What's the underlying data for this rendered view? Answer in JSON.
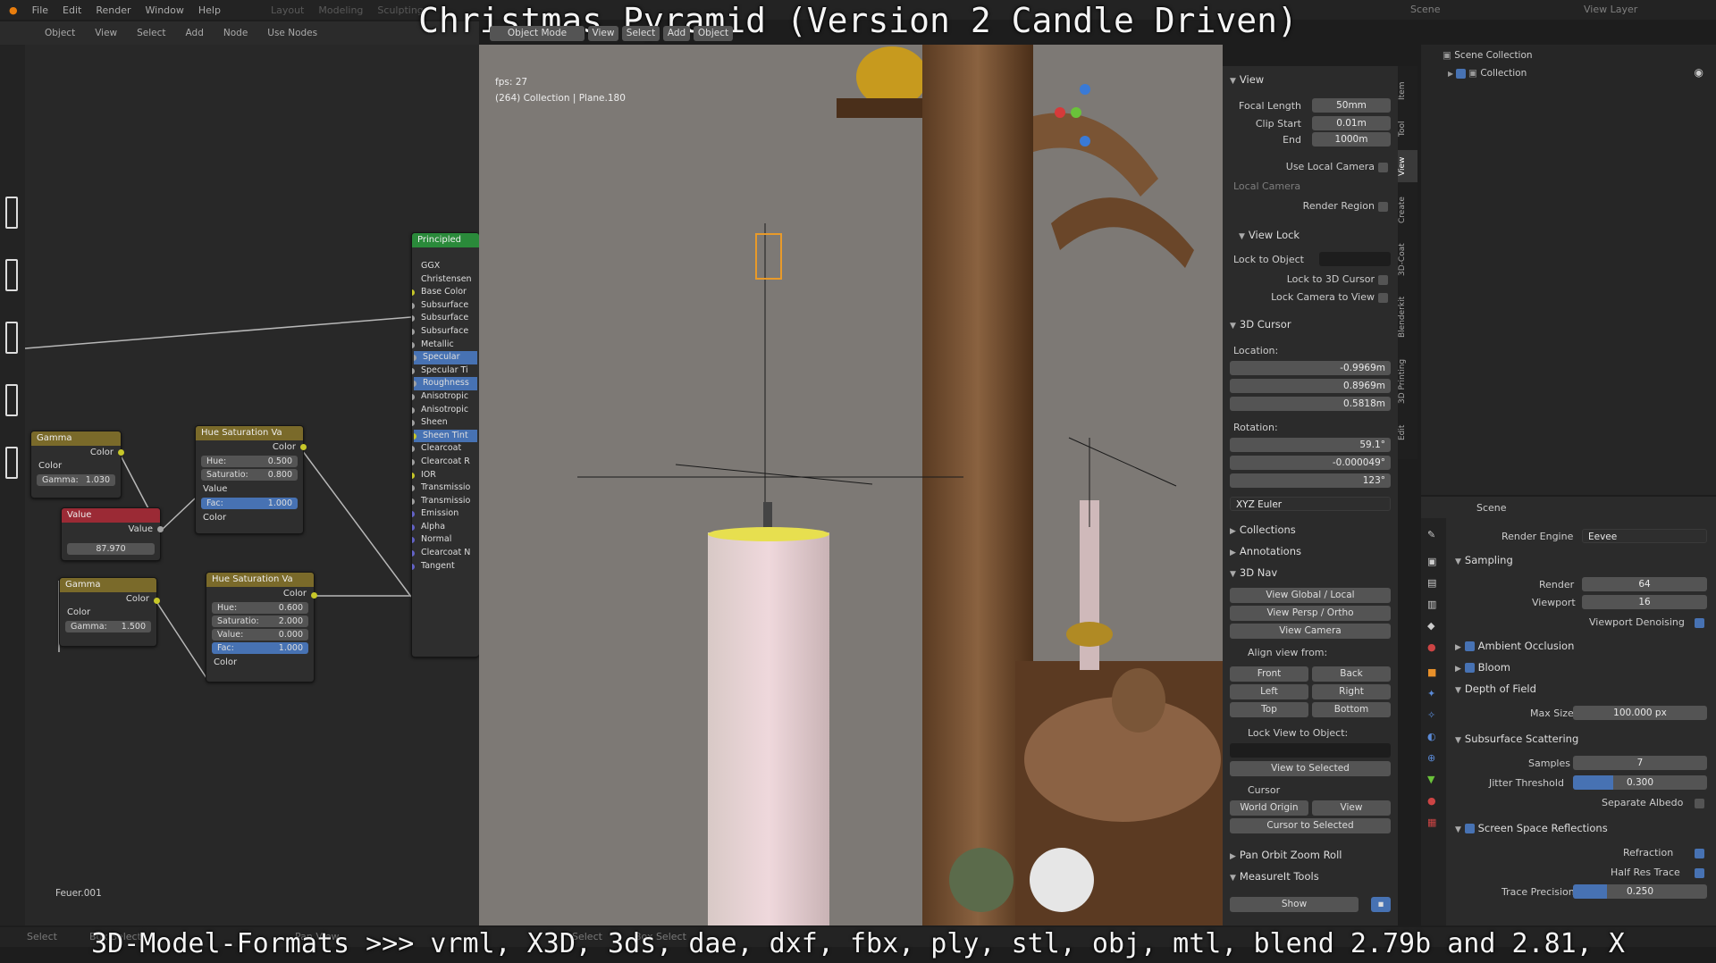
{
  "top_menu": [
    "File",
    "Edit",
    "Render",
    "Window",
    "Help"
  ],
  "workspace_tabs": [
    "Layout",
    "Modeling",
    "Sculpting"
  ],
  "overlay_title": "Christmas Pyramid (Version 2 Candle Driven)",
  "overlay_bottom": "3D-Model-Formats >>> vrml, X3D, 3ds, dae, dxf, fbx, ply, stl, obj, mtl, blend 2.79b and 2.81, X",
  "scene_label": "Scene",
  "view_layer_label": "View Layer",
  "node_editor": {
    "header": [
      "Object",
      "View",
      "Select",
      "Add",
      "Node",
      "Use Nodes"
    ],
    "footer_label": "Feuer.001",
    "nodes": {
      "gamma1": {
        "title": "Gamma",
        "out": "Color",
        "in": "Color",
        "field_label": "Gamma:",
        "field_value": "1.030"
      },
      "value": {
        "title": "Value",
        "out": "Value",
        "field_value": "87.970"
      },
      "gamma2": {
        "title": "Gamma",
        "out": "Color",
        "in": "Color",
        "field_label": "Gamma:",
        "field_value": "1.500"
      },
      "hsv1": {
        "title": "Hue Saturation Va",
        "out": "Color",
        "hue": "0.500",
        "sat": "0.800",
        "val": "Value",
        "fac": "1.000",
        "in": "Color",
        "hue_label": "Hue:",
        "sat_label": "Saturatio:",
        "fac_label": "Fac:"
      },
      "hsv2": {
        "title": "Hue Saturation Va",
        "out": "Color",
        "hue": "0.600",
        "sat": "2.000",
        "val": "0.000",
        "fac": "1.000",
        "in": "Color",
        "hue_label": "Hue:",
        "sat_label": "Saturatio:",
        "val_label": "Value:",
        "fac_label": "Fac:"
      },
      "principled": {
        "title": "Principled",
        "inputs": [
          "GGX",
          "Christensen",
          "Base Color",
          "Subsurface",
          "Subsurface",
          "Subsurface",
          "Metallic",
          "Specular",
          "Specular Ti",
          "Roughness",
          "Anisotropic",
          "Anisotropic",
          "Sheen",
          "Sheen Tint",
          "Clearcoat",
          "Clearcoat R",
          "IOR",
          "Transmissio",
          "Transmissio",
          "Emission",
          "Alpha",
          "Normal",
          "Clearcoat N",
          "Tangent"
        ]
      }
    }
  },
  "viewport": {
    "header": [
      "Object Mode",
      "View",
      "Select",
      "Add",
      "Object"
    ],
    "fps": "fps: 27",
    "collection_info": "(264) Collection | Plane.180"
  },
  "npanel": {
    "view": {
      "title": "View",
      "focal_label": "Focal Length",
      "focal": "50mm",
      "clip_start_label": "Clip Start",
      "clip_start": "0.01m",
      "end_label": "End",
      "end": "1000m",
      "use_local_camera": "Use Local Camera",
      "local_camera": "Local Camera",
      "render_region": "Render Region"
    },
    "view_lock": {
      "title": "View Lock",
      "lock_to_object": "Lock to Object",
      "lock_3d_cursor": "Lock to 3D Cursor",
      "lock_camera": "Lock Camera to View"
    },
    "cursor": {
      "title": "3D Cursor",
      "location": "Location:",
      "x": "-0.9969m",
      "y": "0.8969m",
      "z": "0.5818m",
      "rotation": "Rotation:",
      "rx": "59.1°",
      "ry": "-0.000049°",
      "rz": "123°",
      "mode": "XYZ Euler"
    },
    "collections": "Collections",
    "annotations": "Annotations",
    "nav": {
      "title": "3D Nav",
      "global_local": "View Global / Local",
      "persp_ortho": "View Persp / Ortho",
      "view_camera": "View Camera",
      "align_from": "Align view from:",
      "front": "Front",
      "back": "Back",
      "left": "Left",
      "right": "Right",
      "top": "Top",
      "bottom": "Bottom",
      "lock_view": "Lock View to Object:",
      "view_selected": "View to Selected",
      "cursor": "Cursor",
      "world_origin": "World Origin",
      "view": "View",
      "cursor_selected": "Cursor to Selected"
    },
    "pan_orbit": "Pan Orbit Zoom Roll",
    "measureit": "MeasureIt Tools",
    "show": "Show",
    "tabs": [
      "Item",
      "Tool",
      "View",
      "Create",
      "3D-Coat",
      "Blenderkit",
      "3D Printing",
      "Edit"
    ]
  },
  "outliner": {
    "scene_collection": "Scene Collection",
    "collection": "Collection"
  },
  "properties": {
    "scene": "Scene",
    "render_engine_label": "Render Engine",
    "render_engine": "Eevee",
    "sampling": "Sampling",
    "render_label": "Render",
    "render": "64",
    "viewport_label": "Viewport",
    "viewport": "16",
    "denoise": "Viewport Denoising",
    "ao": "Ambient Occlusion",
    "bloom": "Bloom",
    "dof": "Depth of Field",
    "max_size_label": "Max Size",
    "max_size": "100.000 px",
    "sss": "Subsurface Scattering",
    "samples_label": "Samples",
    "samples": "7",
    "jitter_label": "Jitter Threshold",
    "jitter": "0.300",
    "jitter_fraction": 0.3,
    "sep_albedo": "Separate Albedo",
    "ssr": "Screen Space Reflections",
    "refraction": "Refraction",
    "half_res": "Half Res Trace",
    "trace_label": "Trace Precision",
    "trace": "0.250",
    "trace_fraction": 0.25
  },
  "status": [
    "Select",
    "Box Select",
    "Pan View",
    "Select",
    "Box Select"
  ]
}
